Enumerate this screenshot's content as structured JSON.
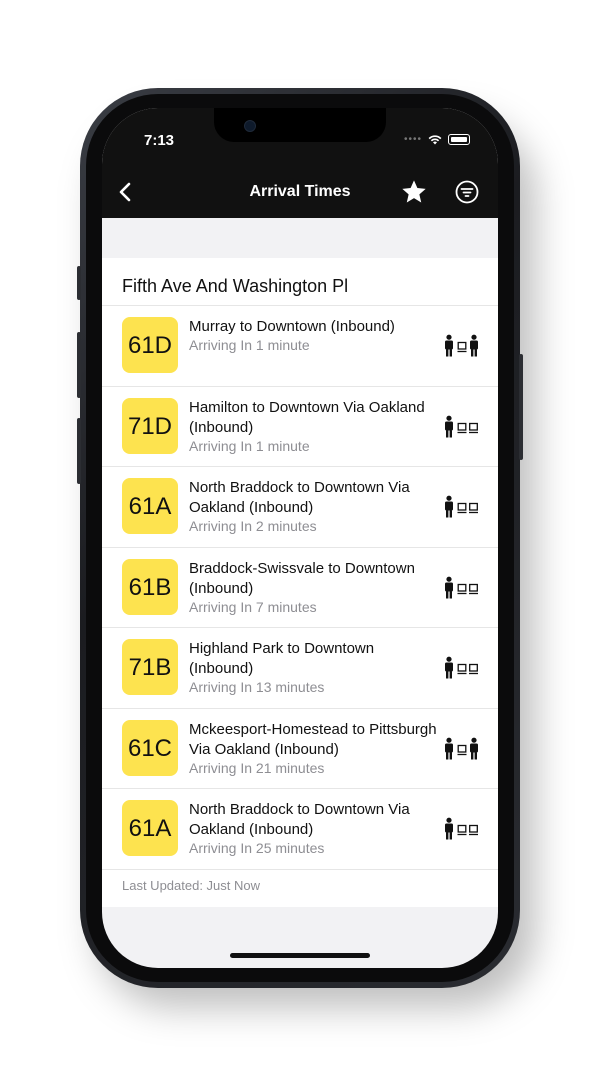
{
  "status": {
    "time": "7:13"
  },
  "nav": {
    "title": "Arrival Times"
  },
  "stop": {
    "name": "Fifth Ave And Washington Pl"
  },
  "arrivals": [
    {
      "route": "61D",
      "name": "Murray to Downtown (Inbound)",
      "eta": "Arriving In 1 minute",
      "occupancy": "many-seats-icon"
    },
    {
      "route": "71D",
      "name": "Hamilton to Downtown Via Oakland (Inbound)",
      "eta": "Arriving In 1 minute",
      "occupancy": "few-riders-icon"
    },
    {
      "route": "61A",
      "name": "North Braddock to Downtown Via Oakland (Inbound)",
      "eta": "Arriving In 2 minutes",
      "occupancy": "few-riders-icon"
    },
    {
      "route": "61B",
      "name": "Braddock-Swissvale to Downtown (Inbound)",
      "eta": "Arriving In 7 minutes",
      "occupancy": "few-riders-icon"
    },
    {
      "route": "71B",
      "name": "Highland Park to Downtown (Inbound)",
      "eta": "Arriving In 13 minutes",
      "occupancy": "few-riders-icon"
    },
    {
      "route": "61C",
      "name": "Mckeesport-Homestead to Pittsburgh Via Oakland (Inbound)",
      "eta": "Arriving In 21 minutes",
      "occupancy": "many-seats-icon"
    },
    {
      "route": "61A",
      "name": "North Braddock to Downtown Via Oakland (Inbound)",
      "eta": "Arriving In 25 minutes",
      "occupancy": "few-riders-icon"
    }
  ],
  "footer": {
    "last_updated": "Last Updated: Just Now"
  },
  "colors": {
    "badge": "#fde34f",
    "bar": "#111111"
  }
}
